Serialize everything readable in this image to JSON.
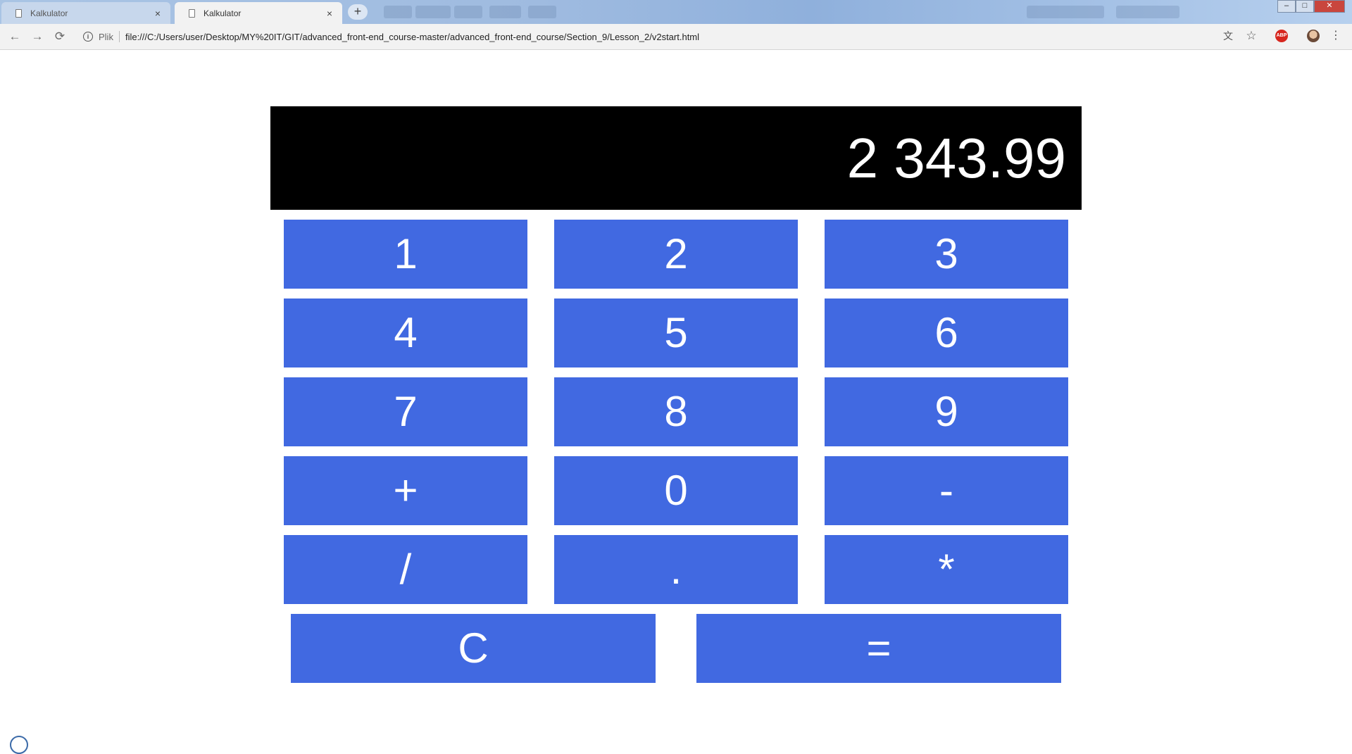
{
  "browser": {
    "tabs": [
      {
        "title": "Kalkulator",
        "close": "×"
      },
      {
        "title": "Kalkulator",
        "close": "×"
      }
    ],
    "new_tab": "+",
    "nav": {
      "back": "←",
      "forward": "→",
      "reload": "⟳"
    },
    "address": {
      "scheme_label": "Plik",
      "url": "file:///C:/Users/user/Desktop/MY%20IT/GIT/advanced_front-end_course-master/advanced_front-end_course/Section_9/Lesson_2/v2start.html"
    },
    "extensions": {
      "abp": "ABP",
      "star": "☆",
      "translate": "文",
      "menu": "⋮"
    },
    "window_controls": {
      "minimize": "–",
      "maximize": "□",
      "close": "✕"
    }
  },
  "calculator": {
    "display": "2 343.99",
    "keys": [
      {
        "label": "1"
      },
      {
        "label": "2"
      },
      {
        "label": "3"
      },
      {
        "label": "4"
      },
      {
        "label": "5"
      },
      {
        "label": "6"
      },
      {
        "label": "7"
      },
      {
        "label": "8"
      },
      {
        "label": "9"
      },
      {
        "label": "+"
      },
      {
        "label": "0"
      },
      {
        "label": "-"
      },
      {
        "label": "/"
      },
      {
        "label": "."
      },
      {
        "label": "*"
      }
    ],
    "clear": "C",
    "equals": "="
  },
  "colors": {
    "key_background": "#4169e1",
    "display_background": "#000000",
    "text": "#ffffff"
  }
}
